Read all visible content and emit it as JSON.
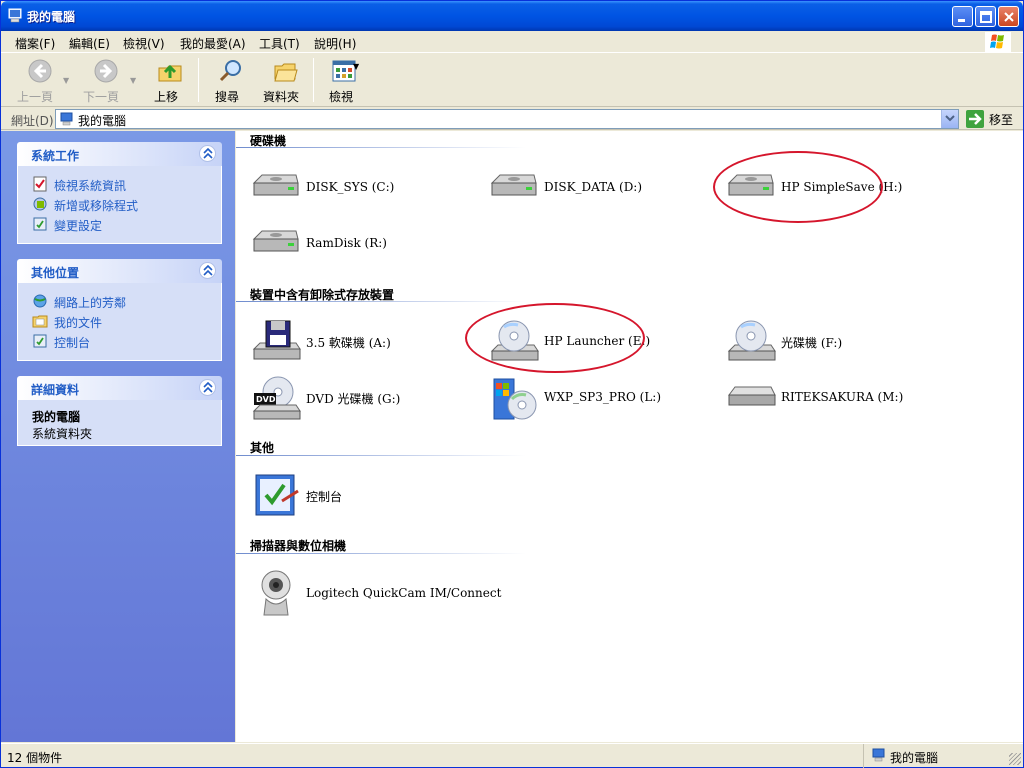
{
  "window": {
    "title": "我的電腦"
  },
  "menu": [
    "檔案(F)",
    "編輯(E)",
    "檢視(V)",
    "我的最愛(A)",
    "工具(T)",
    "說明(H)"
  ],
  "toolbar": {
    "back": "上一頁",
    "forward": "下一頁",
    "up": "上移",
    "search": "搜尋",
    "folders": "資料夾",
    "views": "檢視"
  },
  "address": {
    "label": "網址(D)",
    "value": "我的電腦",
    "go": "移至"
  },
  "sidebar": {
    "system_tasks": {
      "title": "系統工作",
      "items": [
        "檢視系統資訊",
        "新增或移除程式",
        "變更設定"
      ]
    },
    "other_places": {
      "title": "其他位置",
      "items": [
        "網路上的芳鄰",
        "我的文件",
        "控制台"
      ]
    },
    "details": {
      "title": "詳細資料",
      "name": "我的電腦",
      "type": "系統資料夾"
    }
  },
  "groups": {
    "hard_drives": {
      "title": "硬碟機",
      "items": [
        "DISK_SYS (C:)",
        "DISK_DATA (D:)",
        "HP SimpleSave (H:)",
        "RamDisk (R:)"
      ]
    },
    "removable": {
      "title": "裝置中含有卸除式存放裝置",
      "items": [
        "3.5 軟碟機 (A:)",
        "HP Launcher (E:)",
        "光碟機 (F:)",
        "DVD 光碟機 (G:)",
        "WXP_SP3_PRO (L:)",
        "RITEKSAKURA (M:)"
      ]
    },
    "other": {
      "title": "其他",
      "items": [
        "控制台"
      ]
    },
    "scanners": {
      "title": "掃描器與數位相機",
      "items": [
        "Logitech QuickCam IM/Connect"
      ]
    }
  },
  "status": {
    "count": "12 個物件",
    "location": "我的電腦"
  },
  "colors": {
    "title_blue": "#0054E3",
    "link_blue": "#215DC6",
    "highlight_red": "#D5162C"
  }
}
